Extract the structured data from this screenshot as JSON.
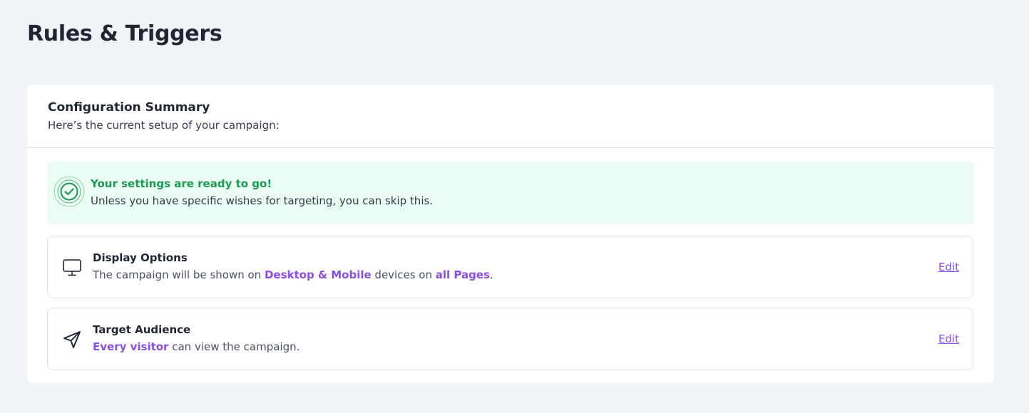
{
  "page": {
    "title": "Rules & Triggers"
  },
  "summary": {
    "title": "Configuration Summary",
    "subtitle": "Here’s the current setup of your campaign:"
  },
  "banner": {
    "icon": "check-circle-icon",
    "title": "Your settings are ready to go!",
    "text": "Unless you have specific wishes for targeting, you can skip this.",
    "color": "#1d9a52",
    "background": "#eafcf3"
  },
  "display_options": {
    "icon": "monitor-icon",
    "title": "Display Options",
    "desc_part1": "The campaign will be shown on ",
    "desc_highlight1": "Desktop & Mobile",
    "desc_part2": " devices on ",
    "desc_highlight2": "all Pages",
    "desc_part3": ".",
    "edit_label": "Edit"
  },
  "target_audience": {
    "icon": "send-arrow-icon",
    "title": "Target Audience",
    "desc_highlight1": "Every visitor",
    "desc_part1": " can view the campaign.",
    "edit_label": "Edit"
  },
  "colors": {
    "accent": "#8a4ee0",
    "background": "#f0f4f7",
    "text": "#1f2533"
  }
}
